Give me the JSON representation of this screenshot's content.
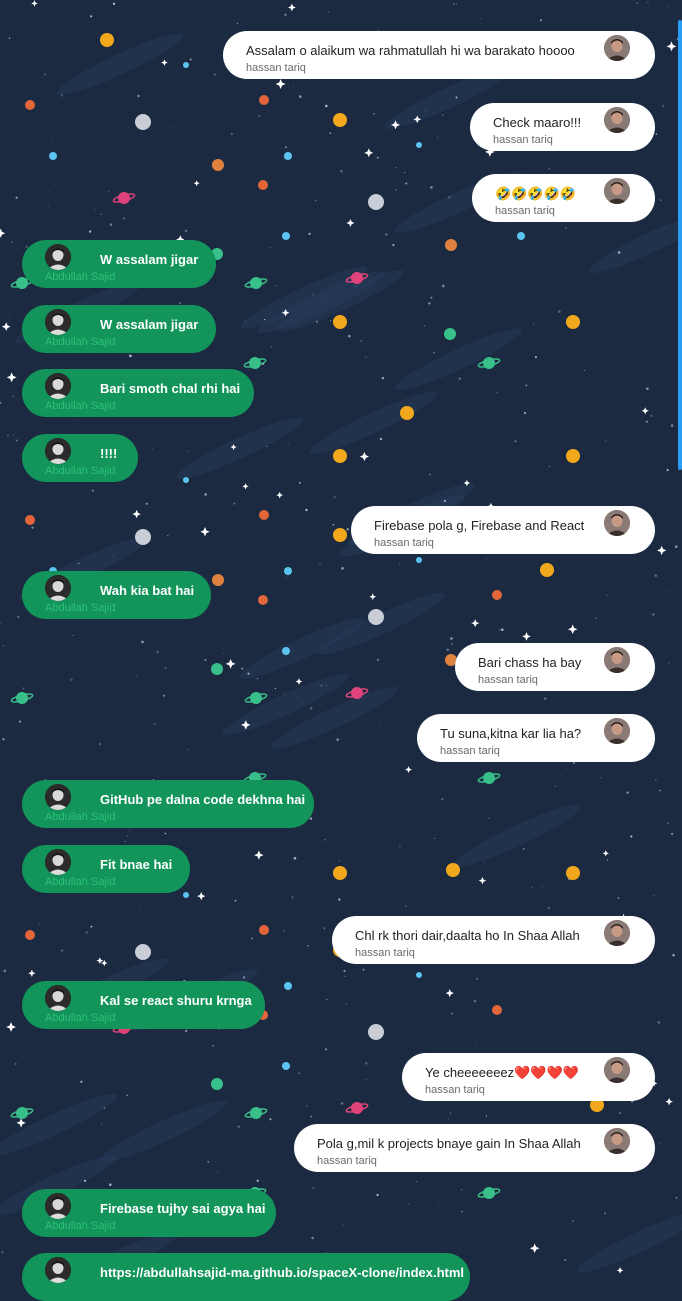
{
  "colors": {
    "background": "#1b2a40",
    "sent_bubble": "#ffffff",
    "received_bubble": "#12945a",
    "received_name": "#2ec07a",
    "scroll_indicator": "#2a9df4"
  },
  "messages": [
    {
      "side": "right",
      "text": "Assalam o alaikum wa rahmatullah hi wa barakato hoooo",
      "sender": "hassan tariq"
    },
    {
      "side": "right",
      "text": "Check maaro!!!",
      "sender": "hassan tariq"
    },
    {
      "side": "right",
      "text": "🤣🤣🤣🤣🤣",
      "sender": "hassan tariq"
    },
    {
      "side": "left",
      "text": "W assalam jigar",
      "sender": "Abdullah Sajid"
    },
    {
      "side": "left",
      "text": "W assalam jigar",
      "sender": "Abdullah Sajid"
    },
    {
      "side": "left",
      "text": "Bari smoth chal rhi hai",
      "sender": "Abdullah Sajid"
    },
    {
      "side": "left",
      "text": "!!!!",
      "sender": "Abdullah Sajid"
    },
    {
      "side": "right",
      "text": "Firebase pola g, Firebase and React",
      "sender": "hassan tariq"
    },
    {
      "side": "left",
      "text": "Wah kia bat hai",
      "sender": "Abdullah Sajid"
    },
    {
      "side": "right",
      "text": "Bari chass ha bay",
      "sender": "hassan tariq"
    },
    {
      "side": "right",
      "text": "Tu suna,kitna kar lia ha?",
      "sender": "hassan tariq"
    },
    {
      "side": "left",
      "text": "GitHub pe dalna code dekhna hai",
      "sender": "Abdullah Sajid"
    },
    {
      "side": "left",
      "text": "Fit bnae hai",
      "sender": "Abdullah Sajid"
    },
    {
      "side": "right",
      "text": "Chl rk thori dair,daalta ho In Shaa Allah",
      "sender": "hassan tariq"
    },
    {
      "side": "left",
      "text": "Kal se react shuru krnga",
      "sender": "Abdullah Sajid"
    },
    {
      "side": "right",
      "text": "Ye cheeeeeeez❤️❤️❤️❤️",
      "sender": "hassan tariq"
    },
    {
      "side": "right",
      "text": "Pola g,mil k projects bnaye gain In Shaa Allah",
      "sender": "hassan tariq"
    },
    {
      "side": "left",
      "text": "Firebase tujhy sai agya hai",
      "sender": "Abdullah Sajid"
    },
    {
      "side": "left",
      "text": "https://abdullahsajid-ma.github.io/spaceX-clone/index.html",
      "sender": ""
    }
  ]
}
